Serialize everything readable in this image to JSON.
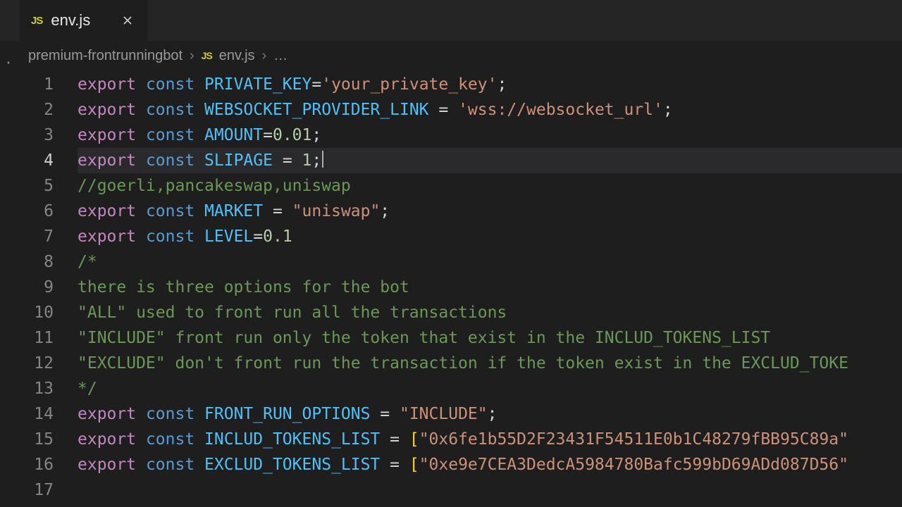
{
  "tab": {
    "icon_text": "JS",
    "filename": "env.js"
  },
  "breadcrumb": {
    "folder": "premium-frontrunningbot",
    "file_icon": "JS",
    "file": "env.js"
  },
  "editor": {
    "active_line": 4,
    "line_count": 17,
    "lines": [
      {
        "n": 1,
        "tokens": [
          {
            "t": "export ",
            "c": "kw-export"
          },
          {
            "t": "const ",
            "c": "kw-const"
          },
          {
            "t": "PRIVATE_KEY",
            "c": "ident"
          },
          {
            "t": "=",
            "c": "op"
          },
          {
            "t": "'your_private_key'",
            "c": "str"
          },
          {
            "t": ";",
            "c": "op"
          }
        ]
      },
      {
        "n": 2,
        "tokens": [
          {
            "t": "export ",
            "c": "kw-export"
          },
          {
            "t": "const ",
            "c": "kw-const"
          },
          {
            "t": "WEBSOCKET_PROVIDER_LINK",
            "c": "ident"
          },
          {
            "t": " = ",
            "c": "op"
          },
          {
            "t": "'wss://websocket_url'",
            "c": "str"
          },
          {
            "t": ";",
            "c": "op"
          }
        ]
      },
      {
        "n": 3,
        "tokens": [
          {
            "t": "export ",
            "c": "kw-export"
          },
          {
            "t": "const ",
            "c": "kw-const"
          },
          {
            "t": "AMOUNT",
            "c": "ident"
          },
          {
            "t": "=",
            "c": "op"
          },
          {
            "t": "0.01",
            "c": "num"
          },
          {
            "t": ";",
            "c": "op"
          }
        ]
      },
      {
        "n": 4,
        "tokens": [
          {
            "t": "export ",
            "c": "kw-export"
          },
          {
            "t": "const ",
            "c": "kw-const"
          },
          {
            "t": "SLIPAGE",
            "c": "ident"
          },
          {
            "t": " = ",
            "c": "op"
          },
          {
            "t": "1",
            "c": "num"
          },
          {
            "t": ";",
            "c": "op"
          }
        ],
        "cursor_after": true
      },
      {
        "n": 5,
        "tokens": [
          {
            "t": "//goerli,pancakeswap,uniswap",
            "c": "cm"
          }
        ]
      },
      {
        "n": 6,
        "tokens": [
          {
            "t": "export ",
            "c": "kw-export"
          },
          {
            "t": "const ",
            "c": "kw-const"
          },
          {
            "t": "MARKET",
            "c": "ident"
          },
          {
            "t": " = ",
            "c": "op"
          },
          {
            "t": "\"uniswap\"",
            "c": "str"
          },
          {
            "t": ";",
            "c": "op"
          }
        ]
      },
      {
        "n": 7,
        "tokens": [
          {
            "t": "export ",
            "c": "kw-export"
          },
          {
            "t": "const ",
            "c": "kw-const"
          },
          {
            "t": "LEVEL",
            "c": "ident"
          },
          {
            "t": "=",
            "c": "op"
          },
          {
            "t": "0.1",
            "c": "num"
          }
        ]
      },
      {
        "n": 8,
        "tokens": [
          {
            "t": "/*",
            "c": "cm"
          }
        ]
      },
      {
        "n": 9,
        "tokens": [
          {
            "t": "there is three options for the bot",
            "c": "cm"
          }
        ]
      },
      {
        "n": 10,
        "tokens": [
          {
            "t": "\"ALL\" used to front run all the transactions",
            "c": "cm"
          }
        ]
      },
      {
        "n": 11,
        "tokens": [
          {
            "t": "\"INCLUDE\" front run only the token that exist in the INCLUD_TOKENS_LIST",
            "c": "cm"
          }
        ]
      },
      {
        "n": 12,
        "tokens": [
          {
            "t": "\"EXCLUDE\" don't front run the transaction if the token exist in the EXCLUD_TOKE",
            "c": "cm"
          }
        ]
      },
      {
        "n": 13,
        "tokens": [
          {
            "t": "*/",
            "c": "cm"
          }
        ]
      },
      {
        "n": 14,
        "tokens": [
          {
            "t": "export ",
            "c": "kw-export"
          },
          {
            "t": "const ",
            "c": "kw-const"
          },
          {
            "t": "FRONT_RUN_OPTIONS",
            "c": "ident"
          },
          {
            "t": " = ",
            "c": "op"
          },
          {
            "t": "\"INCLUDE\"",
            "c": "str"
          },
          {
            "t": ";",
            "c": "op"
          }
        ]
      },
      {
        "n": 15,
        "tokens": [
          {
            "t": "export ",
            "c": "kw-export"
          },
          {
            "t": "const ",
            "c": "kw-const"
          },
          {
            "t": "INCLUD_TOKENS_LIST",
            "c": "ident"
          },
          {
            "t": " = ",
            "c": "op"
          },
          {
            "t": "[",
            "c": "brk-y"
          },
          {
            "t": "\"0x6fe1b55D2F23431F54511E0b1C48279fBB95C89a\"",
            "c": "str"
          }
        ]
      },
      {
        "n": 16,
        "tokens": [
          {
            "t": "export ",
            "c": "kw-export"
          },
          {
            "t": "const ",
            "c": "kw-const"
          },
          {
            "t": "EXCLUD_TOKENS_LIST",
            "c": "ident"
          },
          {
            "t": " = ",
            "c": "op"
          },
          {
            "t": "[",
            "c": "brk-y"
          },
          {
            "t": "\"0xe9e7CEA3DedcA5984780Bafc599bD69ADd087D56\"",
            "c": "str"
          }
        ]
      },
      {
        "n": 17,
        "tokens": []
      }
    ]
  }
}
